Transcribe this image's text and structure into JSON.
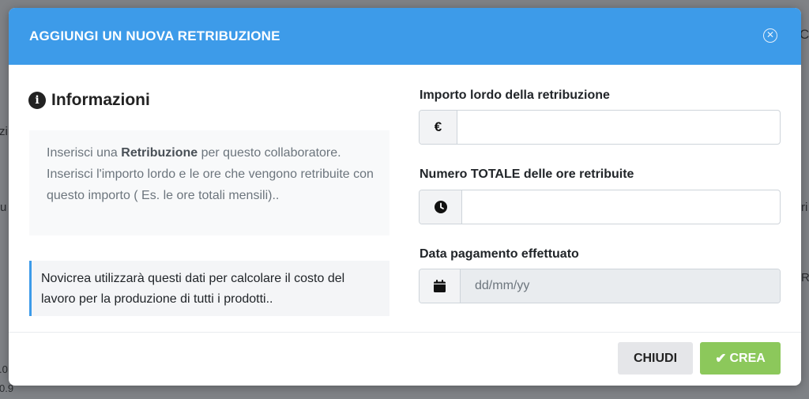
{
  "modal": {
    "title": "AGGIUNGI UN NUOVA RETRIBUZIONE",
    "close_glyph": "✕"
  },
  "info": {
    "heading": "Informazioni",
    "icon_glyph": "i",
    "text_prefix": "Inserisci una ",
    "text_bold": "Retribuzione",
    "text_suffix": " per questo collaboratore. Inserisci l'importo lordo e le ore che vengono retribuite con questo importo ( Es. le ore totali mensili)..",
    "callout": "Novicrea utilizzarà questi dati per calcolare il costo del lavoro per la produzione di tutti i prodotti.."
  },
  "form": {
    "amount": {
      "label": "Importo lordo della retribuzione",
      "addon": "€",
      "value": ""
    },
    "hours": {
      "label": "Numero TOTALE delle ore retribuite",
      "value": ""
    },
    "date": {
      "label": "Data pagamento effettuato",
      "placeholder": "dd/mm/yy"
    }
  },
  "buttons": {
    "close_label": "CHIUDI",
    "create_label": "CREA",
    "create_glyph": "✔"
  },
  "background": {
    "frag_right_top": "Co",
    "frag_left_1": "zi",
    "frag_left_2": "u",
    "frag_right_2": "ri",
    "frag_right_3": "R",
    "frag_left_3": ".0",
    "frag_left_4": "0.9"
  },
  "colors": {
    "header": "#3d9be9",
    "create_button": "#8cc85b",
    "backdrop": "#7f8286"
  }
}
